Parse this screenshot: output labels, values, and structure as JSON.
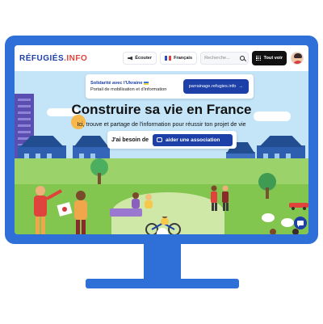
{
  "header": {
    "logo_main": "RÉFUGIÉS",
    "logo_accent": ".INFO",
    "listen_label": "Écouter",
    "language_label": "Français",
    "search_placeholder": "Recherche...",
    "see_all_label": "Tout voir"
  },
  "banner": {
    "title": "Solidarité avec l'Ukraine",
    "subtitle": "Portail de mobilisation et d'information",
    "button_label": "parrainage.refugies.info",
    "button_arrow": "→"
  },
  "hero": {
    "title": "Construire sa vie en France",
    "subtitle": "Ici, trouve et partage de l'information pour réussir ton projet de vie",
    "need_label": "J'ai besoin de",
    "need_value": "aider une association"
  },
  "colors": {
    "brand_blue": "#1c3fa8",
    "frame_blue": "#2f6fd8",
    "accent_red": "#e0433c"
  },
  "icons": {
    "listen": "speaker-icon",
    "language": "flag-france-icon",
    "search": "search-icon",
    "see_all": "grid-icon",
    "chat": "chat-icon",
    "need": "hands-icon"
  }
}
